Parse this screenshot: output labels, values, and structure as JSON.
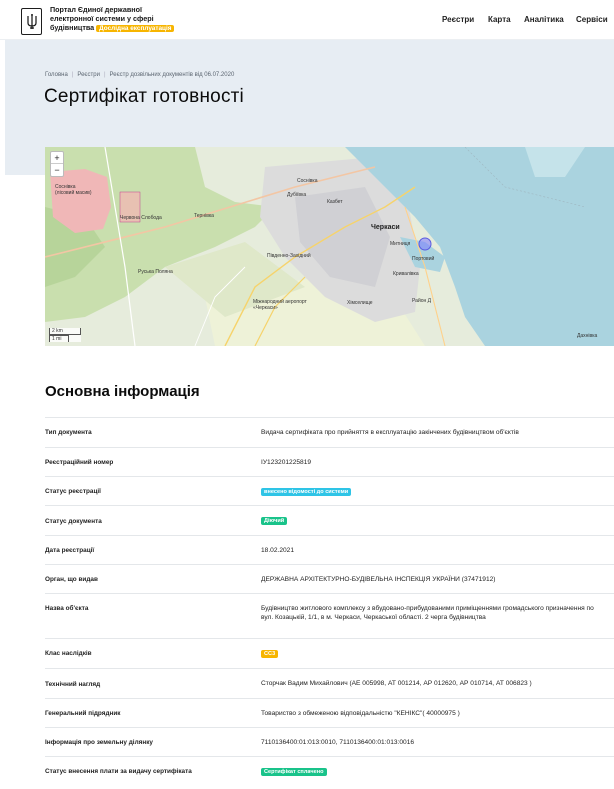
{
  "header": {
    "logo_line1": "Портал Єдиної державної",
    "logo_line2": "електронної системи у сфері",
    "logo_line3": "будівництва",
    "beta_badge": "Дослідна експлуатація",
    "nav": [
      "Реєстри",
      "Карта",
      "Аналітика",
      "Сервіси"
    ]
  },
  "breadcrumb": [
    "Головна",
    "Реєстри",
    "Реєстр дозвільних документів від 06.07.2020"
  ],
  "page_title": "Сертифікат готовності",
  "map": {
    "zoom_in": "+",
    "zoom_out": "−",
    "scale_km": "2 km",
    "scale_mi": "1 mi",
    "labels": [
      "Черкаси",
      "Соснівка",
      "Казбет",
      "Митниця",
      "Портовий",
      "Дахнівка",
      "Хімселище",
      "Район Д",
      "Кривалівка",
      "Південно-Західний",
      "Дубіївка",
      "Червона Слобода",
      "Тернівка",
      "Руська Поляна",
      "Соснівка (лісовий масив)",
      "Міжнародний аеропорт «Черкаси»"
    ]
  },
  "section_title": "Основна інформація",
  "rows": [
    {
      "label": "Тип документа",
      "value": "Видача сертифіката про прийняття в експлуатацію закінчених будівництвом об'єктів"
    },
    {
      "label": "Реєстраційний номер",
      "value": "ІУ123201225819"
    },
    {
      "label": "Статус реєстрації",
      "tag": "внесено відомості до системи",
      "tag_color": "#2ec4e6"
    },
    {
      "label": "Статус документа",
      "tag": "Діючий",
      "tag_color": "#19c38a"
    },
    {
      "label": "Дата реєстрації",
      "value": "18.02.2021"
    },
    {
      "label": "Орган, що видав",
      "value": "ДЕРЖАВНА АРХІТЕКТУРНО-БУДІВЕЛЬНА ІНСПЕКЦІЯ УКРАЇНИ (37471912)"
    },
    {
      "label": "Назва об'єкта",
      "value": "Будівництво житлового комплексу з вбудовано-прибудованими приміщеннями громадського призначення по вул. Козацькій, 1/1, в м. Черкаси, Черкаської області. 2 черга будівництва"
    },
    {
      "label": "Клас наслідків",
      "tag": "СС3",
      "tag_color": "#f7b500"
    },
    {
      "label": "Технічний нагляд",
      "value": "Сторчак Вадим Михайлович (АЕ 005998, АТ 001214, АР 012620, АР 010714, АТ 006823 )"
    },
    {
      "label": "Генеральний підрядник",
      "value": "Товариство з обмеженою відповідальністю \"КЕНІКС\"( 40000975 )"
    },
    {
      "label": "Інформація про земельну ділянку",
      "value": "7110136400:01:013:0010, 7110136400:01:013:0016"
    },
    {
      "label": "Статус внесення плати за видачу сертифіката",
      "tag": "Сертифікат сплачено",
      "tag_color": "#19c38a"
    }
  ]
}
